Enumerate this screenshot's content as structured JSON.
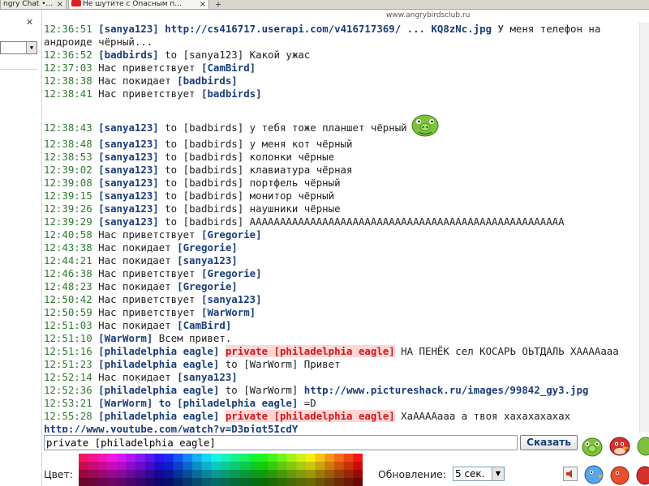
{
  "browser": {
    "tabs": [
      {
        "label": "ngry Chat •..."
      },
      {
        "label": "Не шутите с Опасным п..."
      }
    ],
    "site_url": "www.angrybirdsclub.ru"
  },
  "messages": [
    {
      "time": "12:36:51",
      "parts": [
        {
          "t": "nick",
          "v": "[sanya123]"
        },
        {
          "t": "text",
          "v": " "
        },
        {
          "t": "link",
          "v": "http://cs416717.userapi.com/v416717369/ ... KQ8zNc.jpg"
        },
        {
          "t": "text",
          "v": " У меня телефон на андроиде чёрный..."
        }
      ]
    },
    {
      "time": "12:36:52",
      "parts": [
        {
          "t": "nick",
          "v": "[badbirds]"
        },
        {
          "t": "text",
          "v": " to [sanya123] Какой ужас"
        }
      ]
    },
    {
      "time": "12:37:03",
      "parts": [
        {
          "t": "text",
          "v": "Нас приветствует "
        },
        {
          "t": "nick",
          "v": "[CamBird]"
        }
      ]
    },
    {
      "time": "12:38:38",
      "parts": [
        {
          "t": "text",
          "v": "Нас покидает "
        },
        {
          "t": "nick",
          "v": "[badbirds]"
        }
      ]
    },
    {
      "time": "12:38:41",
      "parts": [
        {
          "t": "text",
          "v": "Нас приветствует "
        },
        {
          "t": "nick",
          "v": "[badbirds]"
        }
      ]
    },
    {
      "time": "",
      "parts": []
    },
    {
      "time": "12:38:43",
      "parts": [
        {
          "t": "nick",
          "v": "[sanya123]"
        },
        {
          "t": "text",
          "v": " to [badbirds] у тебя тоже планшет чёрный"
        },
        {
          "t": "smiley",
          "v": "pig-smiley"
        }
      ]
    },
    {
      "time": "12:38:48",
      "parts": [
        {
          "t": "nick",
          "v": "[sanya123]"
        },
        {
          "t": "text",
          "v": " to [badbirds] у меня кот чёрный"
        }
      ]
    },
    {
      "time": "12:38:53",
      "parts": [
        {
          "t": "nick",
          "v": "[sanya123]"
        },
        {
          "t": "text",
          "v": " to [badbirds] колонки чёрные"
        }
      ]
    },
    {
      "time": "12:39:02",
      "parts": [
        {
          "t": "nick",
          "v": "[sanya123]"
        },
        {
          "t": "text",
          "v": " to [badbirds] клавиатура чёрная"
        }
      ]
    },
    {
      "time": "12:39:08",
      "parts": [
        {
          "t": "nick",
          "v": "[sanya123]"
        },
        {
          "t": "text",
          "v": " to [badbirds] портфель чёрный"
        }
      ]
    },
    {
      "time": "12:39:15",
      "parts": [
        {
          "t": "nick",
          "v": "[sanya123]"
        },
        {
          "t": "text",
          "v": " to [badbirds] монитор чёрный"
        }
      ]
    },
    {
      "time": "12:39:26",
      "parts": [
        {
          "t": "nick",
          "v": "[sanya123]"
        },
        {
          "t": "text",
          "v": " to [badbirds] наушники чёрные"
        }
      ]
    },
    {
      "time": "12:39:29",
      "parts": [
        {
          "t": "nick",
          "v": "[sanya123]"
        },
        {
          "t": "text",
          "v": " to [badbirds] АААААААААААААААААААААААААААААААААААААААААААААААААААА"
        }
      ]
    },
    {
      "time": "12:40:58",
      "parts": [
        {
          "t": "text",
          "v": "Нас приветствует "
        },
        {
          "t": "nick",
          "v": "[Gregorie]"
        }
      ]
    },
    {
      "time": "12:43:38",
      "parts": [
        {
          "t": "text",
          "v": "Нас покидает "
        },
        {
          "t": "nick",
          "v": "[Gregorie]"
        }
      ]
    },
    {
      "time": "12:44:21",
      "parts": [
        {
          "t": "text",
          "v": "Нас покидает "
        },
        {
          "t": "nick",
          "v": "[sanya123]"
        }
      ]
    },
    {
      "time": "12:46:38",
      "parts": [
        {
          "t": "text",
          "v": "Нас приветствует "
        },
        {
          "t": "nick",
          "v": "[Gregorie]"
        }
      ]
    },
    {
      "time": "12:48:23",
      "parts": [
        {
          "t": "text",
          "v": "Нас покидает "
        },
        {
          "t": "nick",
          "v": "[Gregorie]"
        }
      ]
    },
    {
      "time": "12:50:42",
      "parts": [
        {
          "t": "text",
          "v": "Нас приветствует "
        },
        {
          "t": "nick",
          "v": "[sanya123]"
        }
      ]
    },
    {
      "time": "12:50:59",
      "parts": [
        {
          "t": "text",
          "v": "Нас приветствует "
        },
        {
          "t": "nick",
          "v": "[WarWorm]"
        }
      ]
    },
    {
      "time": "12:51:03",
      "parts": [
        {
          "t": "text",
          "v": "Нас покидает "
        },
        {
          "t": "nick",
          "v": "[CamBird]"
        }
      ]
    },
    {
      "time": "12:51:10",
      "parts": [
        {
          "t": "nick",
          "v": "[WarWorm]"
        },
        {
          "t": "text",
          "v": " Всем привет."
        }
      ]
    },
    {
      "time": "12:51:16",
      "parts": [
        {
          "t": "nick",
          "v": "[philadelphia eagle]"
        },
        {
          "t": "text",
          "v": " "
        },
        {
          "t": "priv",
          "v": "private [philadelphia eagle]"
        },
        {
          "t": "text",
          "v": " НА ПЕНЁК сел КОСАРЬ ОЬТДАЛЬ ХААААааа"
        }
      ]
    },
    {
      "time": "12:51:23",
      "parts": [
        {
          "t": "nick",
          "v": "[philadelphia eagle]"
        },
        {
          "t": "text",
          "v": " to [WarWorm] Привет"
        }
      ]
    },
    {
      "time": "12:52:14",
      "parts": [
        {
          "t": "text",
          "v": "Нас покидает "
        },
        {
          "t": "nick",
          "v": "[sanya123]"
        }
      ]
    },
    {
      "time": "12:52:36",
      "parts": [
        {
          "t": "nick",
          "v": "[philadelphia eagle]"
        },
        {
          "t": "text",
          "v": " to [WarWorm] "
        },
        {
          "t": "link",
          "v": "http://www.pictureshack.ru/images/99842_gy3.jpg"
        }
      ]
    },
    {
      "time": "12:53:21",
      "parts": [
        {
          "t": "nick",
          "v": "[WarWorm]"
        },
        {
          "t": "tobold",
          "v": " to [philadelphia eagle]"
        },
        {
          "t": "text",
          "v": " =D"
        }
      ]
    },
    {
      "time": "12:55:28",
      "parts": [
        {
          "t": "nick",
          "v": "[philadelphia eagle]"
        },
        {
          "t": "text",
          "v": " "
        },
        {
          "t": "priv",
          "v": "private [philadelphia eagle]"
        },
        {
          "t": "text",
          "v": " ХаААААааа а твоя хахахахахах "
        },
        {
          "t": "link",
          "v": "http://www.youtube.com/watch?v=D3pjqt5IcdY"
        }
      ]
    }
  ],
  "composer": {
    "input_value": "private [philadelphia eagle]",
    "send_label": "Сказать"
  },
  "bottom": {
    "color_label": "Цвет:",
    "update_label": "Обновление:",
    "update_value": "5 сек."
  },
  "colors": {
    "timestamp": "#2f7a2f",
    "nick": "#1a3d7a",
    "private": "#d01818",
    "private_bg": "#ffd6d6"
  }
}
